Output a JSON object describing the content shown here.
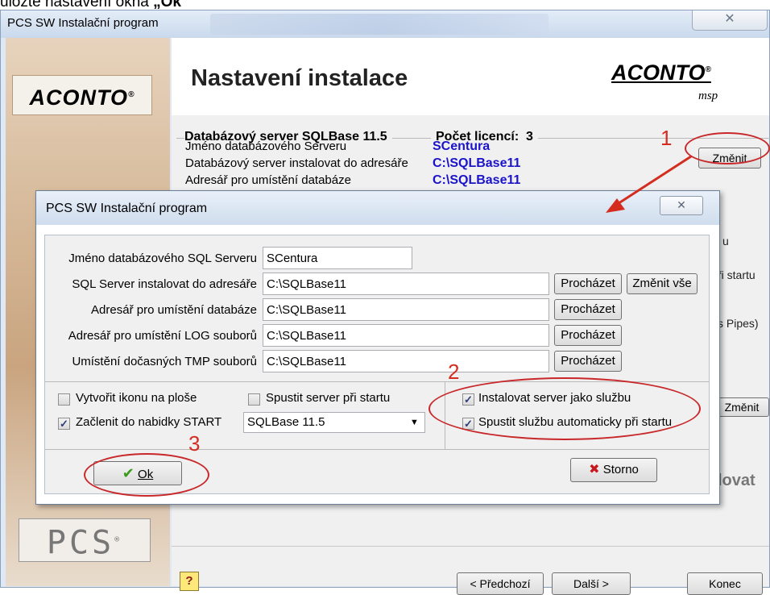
{
  "caption": {
    "prefix": "uložte nastavení okna ",
    "quote": "„Ok"
  },
  "background_window": {
    "title": "PCS SW Instalační program",
    "close_glyph": "✕",
    "logo_left": "ACONTO",
    "logo_right": "ACONTO",
    "logo_right_sub": "msp",
    "registered": "®",
    "heading": "Nastavení instalace",
    "db_group_title": "Databázový server SQLBase 11.5",
    "licence_label": "Počet licencí:",
    "licence_value": "3",
    "rows": [
      {
        "label": "Jméno databázového Serveru",
        "value": "SCentura"
      },
      {
        "label": "Databázový server instalovat do adresáře",
        "value": "C:\\SQLBase11"
      },
      {
        "label": "Adresář pro umístění databáze",
        "value": "C:\\SQLBase11"
      }
    ],
    "change_button": "Změnit",
    "change_button_2": "Změnit",
    "fragments": {
      "u": "u",
      "pri_startu": "ři startu",
      "pipes": "s Pipes)",
      "lovat": "lovat"
    },
    "pcs_logo": "PCS",
    "help": "?",
    "nav": {
      "prev": "< Předchozí",
      "next": "Další >",
      "end": "Konec"
    }
  },
  "dialog": {
    "title": "PCS SW Instalační program",
    "close_glyph": "✕",
    "fields": [
      {
        "label": "Jméno databázového SQL Serveru",
        "value": "SCentura"
      },
      {
        "label": "SQL Server instalovat do adresáře",
        "value": "C:\\SQLBase11"
      },
      {
        "label": "Adresář pro umístění databáze",
        "value": "C:\\SQLBase11"
      },
      {
        "label": "Adresář pro umístění LOG souborů",
        "value": "C:\\SQLBase11"
      },
      {
        "label": "Umístění dočasných TMP souborů",
        "value": "C:\\SQLBase11"
      }
    ],
    "browse_label": "Procházet",
    "change_all_label": "Změnit vše",
    "options": {
      "create_icon": {
        "label": "Vytvořit ikonu na ploše",
        "checked": false
      },
      "start_on_boot": {
        "label": "Spustit server při startu",
        "checked": false
      },
      "start_menu": {
        "label": "Začlenit do nabidky START",
        "checked": true
      },
      "start_menu_select": "SQLBase 11.5",
      "install_service": {
        "label": "Instalovat server jako službu",
        "checked": true
      },
      "auto_service": {
        "label": "Spustit službu automaticky při startu",
        "checked": true
      }
    },
    "check_glyph": "✓",
    "ok_label": "Ok",
    "ok_icon": "✔",
    "cancel_label": "Storno",
    "cancel_icon": "✖"
  },
  "annotations": {
    "one": "1",
    "two": "2",
    "three": "3",
    "color": "#d42d20"
  }
}
